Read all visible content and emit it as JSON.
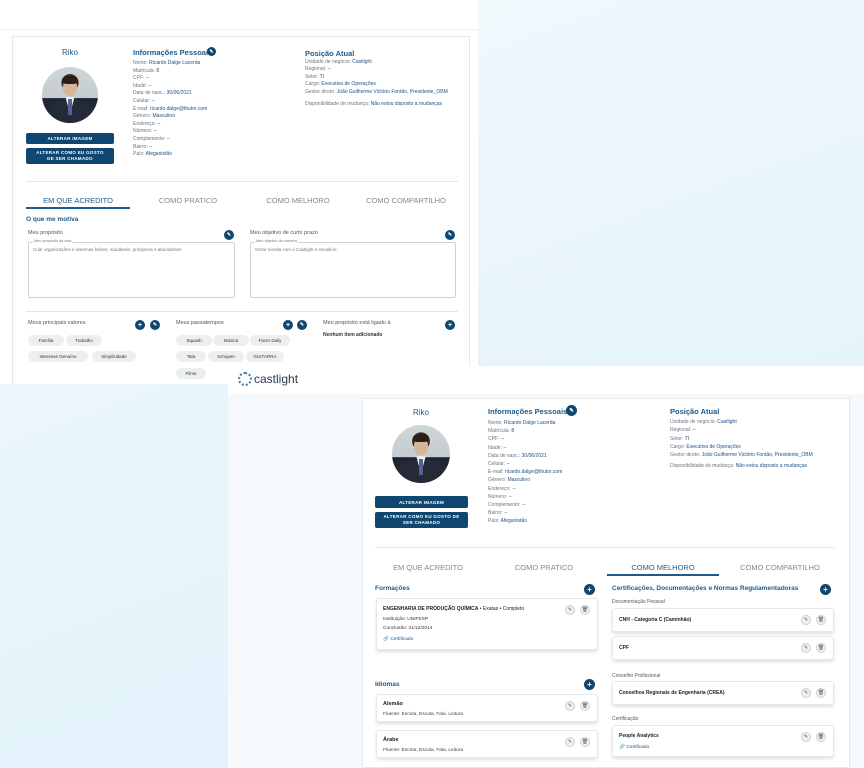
{
  "back": {
    "profile": {
      "name": "Riko",
      "btn_change_image": "ALTERAR IMAGEM",
      "btn_change_name": "ALTERAR COMO EU GOSTO DE SER CHAMADO"
    },
    "personal": {
      "title": "Informações Pessoais",
      "rows": [
        {
          "label": "Nome:",
          "value": "Ricardo Dalge Lacerda"
        },
        {
          "label": "Matrícula:",
          "value": "8"
        },
        {
          "label": "CPF:",
          "value": "--"
        },
        {
          "label": "Idade:",
          "value": "--"
        },
        {
          "label": "Data de nasc.:",
          "value": "30/06/2021"
        },
        {
          "label": "Celular:",
          "value": "--"
        },
        {
          "label": "E-mail:",
          "value": "ricardo.dalge@thutor.com"
        },
        {
          "label": "Gênero:",
          "value": "Masculino"
        },
        {
          "label": "Endereço:",
          "value": "--"
        },
        {
          "label": "Número:",
          "value": "--"
        },
        {
          "label": "Complemento:",
          "value": "--"
        },
        {
          "label": "Bairro:",
          "value": "--"
        },
        {
          "label": "País:",
          "value": "Afeganistão"
        }
      ]
    },
    "position": {
      "title": "Posição Atual",
      "rows": [
        {
          "label": "Unidade de negócio:",
          "value": "Castlight"
        },
        {
          "label": "Regional:",
          "value": "--"
        },
        {
          "label": "Setor:",
          "value": "TI"
        },
        {
          "label": "Cargo:",
          "value": "Executiva de Operações"
        },
        {
          "label": "Gestor direto:",
          "value": "João Guilherme Victório Fontão, Presidente_OBM"
        }
      ],
      "availability_label": "Disponibilidade de mudança:",
      "availability_value": "Não estou disposto a mudanças"
    },
    "tabs": [
      "EM QUE ACREDITO",
      "COMO PRATICO",
      "COMO MELHORO",
      "COMO COMPARTILHO"
    ],
    "motiva_title": "O que me motiva",
    "purpose": {
      "label": "Meu propósito",
      "field_label": "Meu propósito de vida",
      "value": "Criar organizações e sistemas felizes, saudáveis, prósperos e abundantes."
    },
    "goal": {
      "label": "Meu objetivo de curto prazo",
      "field_label": "Meu objetivo de carreira",
      "value": "Gerar receita com o Castlight e escalá-lo"
    },
    "values": {
      "label": "Meus principais valores",
      "chips": [
        "Família",
        "Trabalho",
        "Interesse Genuíno",
        "Simplicidade"
      ]
    },
    "hobbies": {
      "label": "Meus passatempos",
      "chips": [
        "Squash",
        "Música",
        "Fazer Daily",
        "Tata",
        "Schopen",
        "GUITARRA",
        "Filme"
      ]
    },
    "linked": {
      "label": "Meu propósito está ligado à",
      "empty": "Nenhum item adicionado"
    }
  },
  "front": {
    "logo_text": "castlight",
    "profile": {
      "name": "Riko",
      "btn_change_image": "ALTERAR IMAGEM",
      "btn_change_name": "ALTERAR COMO EU GOSTO DE SER CHAMADO"
    },
    "personal": {
      "title": "Informações Pessoais",
      "rows": [
        {
          "label": "Nome:",
          "value": "Ricardo Dalge Lacerda"
        },
        {
          "label": "Matrícula:",
          "value": "8"
        },
        {
          "label": "CPF:",
          "value": "--"
        },
        {
          "label": "Idade:",
          "value": "--"
        },
        {
          "label": "Data de nasc.:",
          "value": "30/06/2021"
        },
        {
          "label": "Celular:",
          "value": "--"
        },
        {
          "label": "E-mail:",
          "value": "ricardo.dalge@thutor.com"
        },
        {
          "label": "Gênero:",
          "value": "Masculino"
        },
        {
          "label": "Endereço:",
          "value": "--"
        },
        {
          "label": "Número:",
          "value": "--"
        },
        {
          "label": "Complemento:",
          "value": "--"
        },
        {
          "label": "Bairro:",
          "value": "--"
        },
        {
          "label": "País:",
          "value": "Afeganistão"
        }
      ]
    },
    "position": {
      "title": "Posição Atual",
      "rows": [
        {
          "label": "Unidade de negócio:",
          "value": "Castlight"
        },
        {
          "label": "Regional:",
          "value": "--"
        },
        {
          "label": "Setor:",
          "value": "TI"
        },
        {
          "label": "Cargo:",
          "value": "Executiva de Operações"
        },
        {
          "label": "Gestor direto:",
          "value": "João Guilherme Victório Fontão, Presidente_OBM"
        }
      ],
      "availability_label": "Disponibilidade de mudança:",
      "availability_value": "Não estou disposto a mudanças"
    },
    "tabs": [
      "EM QUE ACREDITO",
      "COMO PRATICO",
      "COMO MELHORO",
      "COMO COMPARTILHO"
    ],
    "formacoes": {
      "title": "Formações",
      "item_title": "ENGENHARIA DE PRODUÇÃO QUÍMICA",
      "item_area": "Exatas",
      "item_status": "Completo",
      "institution": "Instituição: UNIFESP",
      "conclusion": "Conclusão: 31/12/2014",
      "certificate": "Certificado"
    },
    "idiomas": {
      "title": "Idiomas",
      "items": [
        {
          "name": "Alemão",
          "detail": "Fluente: Escrita, Escuta, Fala, Leitura"
        },
        {
          "name": "Árabe",
          "detail": "Fluente: Escrita, Escuta, Fala, Leitura"
        }
      ]
    },
    "certs": {
      "title": "Certificações, Documentações e Normas Regulamentadoras",
      "group1": "Documentação Pessoal",
      "item1": "CNH - Categoria C (Caminhão)",
      "item2": "CPF",
      "group2": "Conselho Profissional",
      "item3": "Conselhos Regionais de Engenharia (CREA)",
      "group3": "Certificação",
      "item4": "People Analytics",
      "item4_link": "Certificado"
    }
  },
  "colors": {
    "primary": "#0f4770",
    "title_blue": "#1e5a8a",
    "value_blue": "#1e4f86",
    "chip_bg": "#eceff1"
  }
}
